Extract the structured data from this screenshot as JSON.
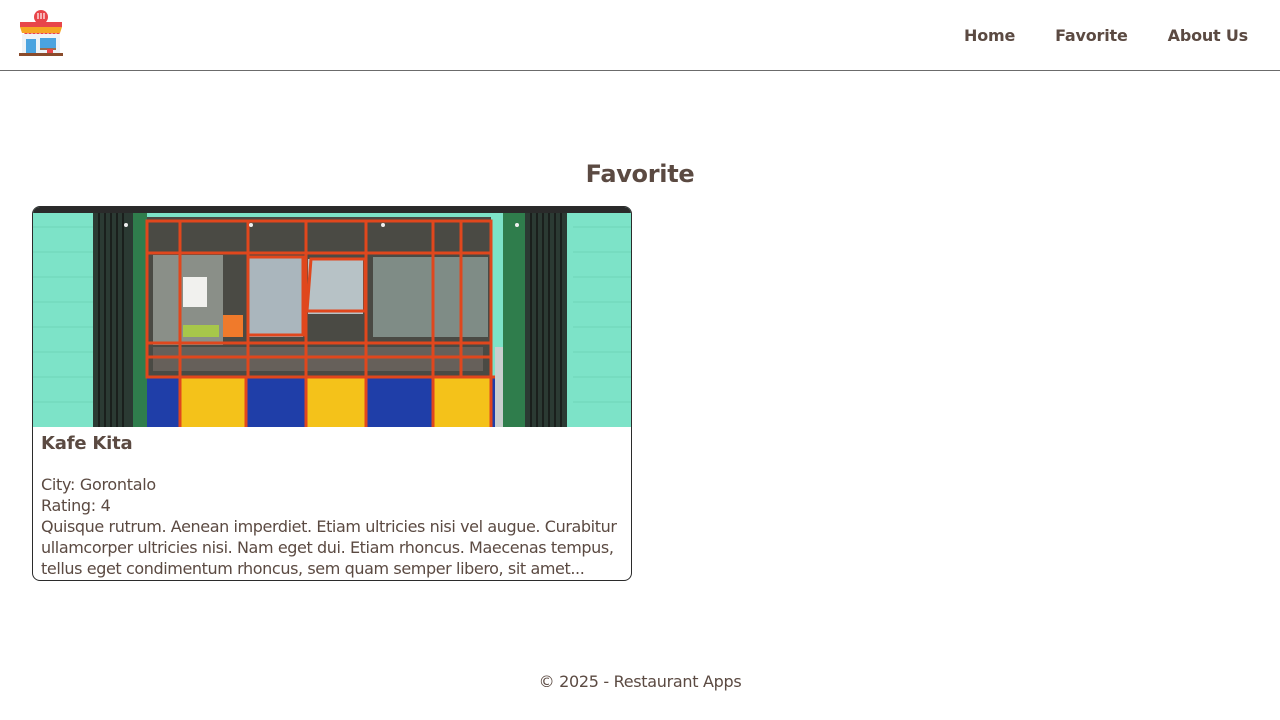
{
  "header": {
    "logo_alt": "Restaurant Apps logo",
    "nav": [
      {
        "label": "Home"
      },
      {
        "label": "Favorite"
      },
      {
        "label": "About Us"
      }
    ]
  },
  "main": {
    "title": "Favorite",
    "restaurants": [
      {
        "name": "Kafe Kita",
        "city": "City: Gorontalo",
        "rating": "Rating: 4",
        "description": "Quisque rutrum. Aenean imperdiet. Etiam ultricies nisi vel augue. Curabitur ullamcorper ultricies nisi. Nam eget dui. Etiam rhoncus. Maecenas tempus, tellus eget condimentum rhoncus, sem quam semper libero, sit amet..."
      }
    ]
  },
  "footer": {
    "text": "© 2025 - Restaurant Apps"
  },
  "colors": {
    "text": "#5b4a42",
    "card_border": "#2b2b2b",
    "header_border": "#6b6b6b"
  }
}
